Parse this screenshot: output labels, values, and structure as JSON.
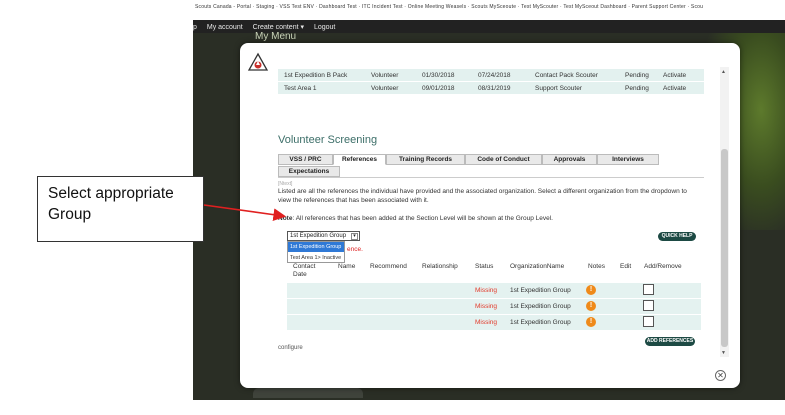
{
  "browser": {
    "bookmarks_text": "Scouts Canada - Portal · Staging · VSS Test ENV · Dashboard Test · ITC Incident Test · Online Meeting Weasels · Scouts MySceoute · Test MyScouter · Test MySceout Dashboard · Parent Support Center · Scou",
    "nav": [
      "p",
      "My account",
      "Create content ▾",
      "Logout"
    ],
    "page_heading": "My Menu"
  },
  "areas": [
    {
      "name": "1st Expedition B Pack",
      "role": "Volunteer",
      "start": "01/30/2018",
      "end": "07/24/2018",
      "position": "Contact Pack Scouter",
      "status": "Pending",
      "action": "Activate"
    },
    {
      "name": "Test Area 1",
      "role": "Volunteer",
      "start": "09/01/2018",
      "end": "08/31/2019",
      "position": "Support Scouter",
      "status": "Pending",
      "action": "Activate"
    }
  ],
  "screening": {
    "title": "Volunteer Screening",
    "tabs": [
      "VSS / PRC",
      "References",
      "Training Records",
      "Code of Conduct",
      "Approvals",
      "Interviews",
      "Expectations"
    ],
    "faded_label": "[Ntext]",
    "description": "Listed are all the references the individual have provided and the associated organization. Select a different organization from the dropdown to view the references that has been associated with it.",
    "note_label": "Note",
    "note_text": ": All references that has been added at the Section Level will be shown at the Group Level.",
    "select_value": "1st Expedition Group",
    "options": [
      "1st Expedition Group",
      "Test Area 1> Inactive"
    ],
    "red_text": "ence.",
    "quick_help": "QUICK HELP",
    "add_references": "ADD REFERENCES",
    "configure": "configure"
  },
  "references_table": {
    "headers": [
      "Contact Date",
      "Name",
      "Recommend",
      "Relationship",
      "Status",
      "OrganizationName",
      "Notes",
      "Edit",
      "Add/Remove"
    ],
    "rows": [
      {
        "status": "Missing",
        "organization": "1st Expedition Group"
      },
      {
        "status": "Missing",
        "organization": "1st Expedition Group"
      },
      {
        "status": "Missing",
        "organization": "1st Expedition Group"
      }
    ]
  },
  "annotation": {
    "text": "Select appropriate Group"
  },
  "colors": {
    "accent": "#1d4a44",
    "row_bg": "#e4f2f0",
    "missing": "#e23a2a",
    "info_icon": "#ef8a1a",
    "arrow": "#e02020"
  },
  "icons": {
    "close": "close-icon",
    "notes": "info-icon",
    "logo": "scouts-logo"
  }
}
